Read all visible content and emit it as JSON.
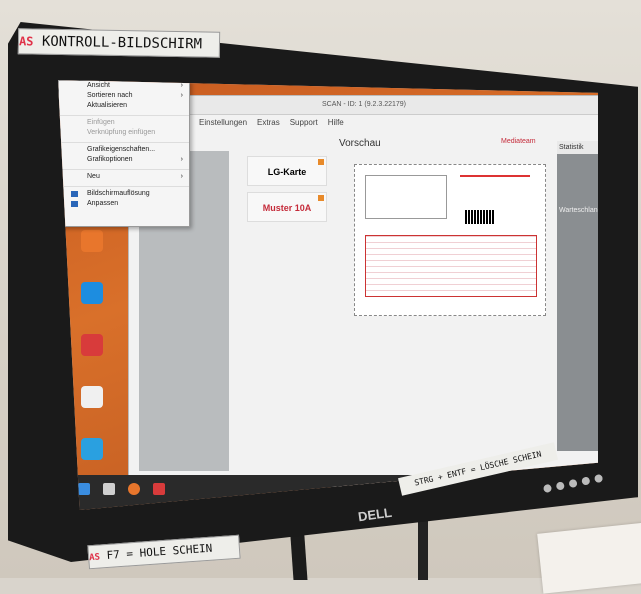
{
  "labels": {
    "top_prefix": "AS",
    "top_text": "KONTROLL-BILDSCHIRM",
    "bottom_prefix": "AS",
    "bottom_text": "F7 = HOLE SCHEIN",
    "strg_text": "STRG + ENTF = LÖSCHE SCHEIN",
    "brand": "DELL"
  },
  "app": {
    "title": "SCAN - ID: 1 (9.2.3.22179)",
    "menu": [
      "Einstellungen",
      "Extras",
      "Support",
      "Hilfe"
    ],
    "vorschau": "Vorschau",
    "mediateam": "Mediateam",
    "statistik": "Statistik",
    "warteschlange": "Warteschlange",
    "cards": [
      {
        "label": "LG-Karte",
        "red": false
      },
      {
        "label": "Muster 10A",
        "red": true
      }
    ]
  },
  "context_menu": {
    "items": [
      {
        "label": "Ansicht",
        "arrow": true,
        "disabled": false
      },
      {
        "label": "Sortieren nach",
        "arrow": true,
        "disabled": false
      },
      {
        "label": "Aktualisieren",
        "arrow": false,
        "disabled": false
      },
      {
        "sep": true
      },
      {
        "label": "Einfügen",
        "arrow": false,
        "disabled": true
      },
      {
        "label": "Verknüpfung einfügen",
        "arrow": false,
        "disabled": true
      },
      {
        "sep": true
      },
      {
        "label": "Grafikeigenschaften...",
        "arrow": false,
        "disabled": false
      },
      {
        "label": "Grafikoptionen",
        "arrow": true,
        "disabled": false
      },
      {
        "sep": true
      },
      {
        "label": "Neu",
        "arrow": true,
        "disabled": false
      },
      {
        "sep": true
      },
      {
        "label": "Bildschirmauflösung",
        "arrow": false,
        "disabled": false,
        "icon": true
      },
      {
        "label": "Anpassen",
        "arrow": false,
        "disabled": false,
        "icon": true
      }
    ]
  },
  "colors": {
    "accent_red": "#c52b3a",
    "desktop_orange": "#d9702a"
  }
}
